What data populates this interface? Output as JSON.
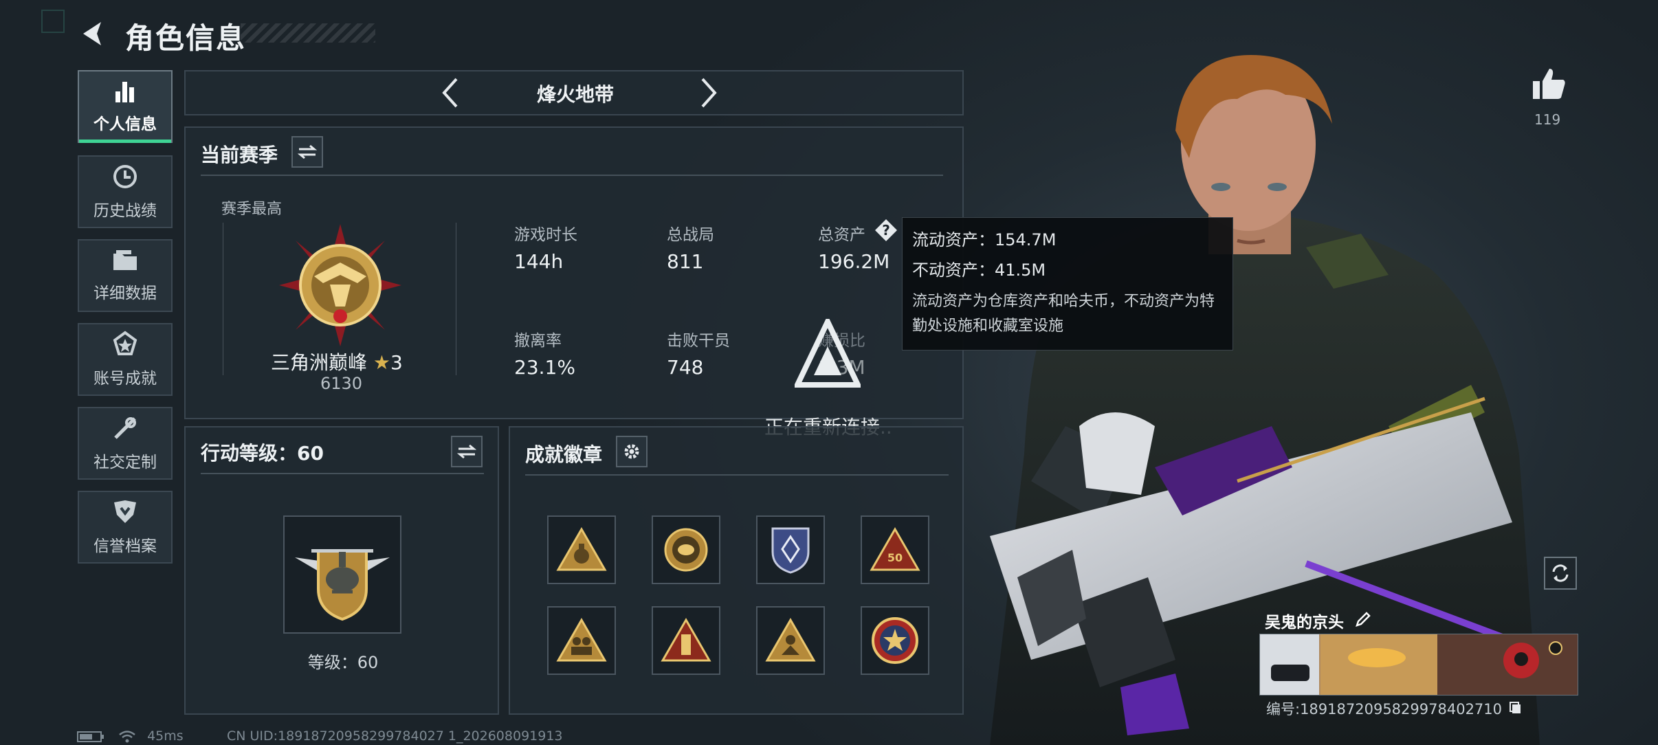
{
  "header": {
    "title": "角色信息"
  },
  "nav": [
    {
      "label": "个人信息",
      "icon": "bar-chart-icon",
      "active": true
    },
    {
      "label": "历史战绩",
      "icon": "clock-icon",
      "active": false
    },
    {
      "label": "详细数据",
      "icon": "folder-icon",
      "active": false
    },
    {
      "label": "账号成就",
      "icon": "medal-icon",
      "active": false
    },
    {
      "label": "社交定制",
      "icon": "wrench-icon",
      "active": false
    },
    {
      "label": "信誉档案",
      "icon": "shield-icon",
      "active": false
    }
  ],
  "mode": {
    "label": "烽火地带"
  },
  "season": {
    "title": "当前赛季",
    "best_label": "赛季最高",
    "rank_name": "三角洲巅峰",
    "rank_stars": "3",
    "rank_score": "6130",
    "stats": [
      {
        "label": "游戏时长",
        "value": "144h"
      },
      {
        "label": "总战局",
        "value": "811"
      },
      {
        "label": "总资产",
        "value": "196.2M"
      },
      {
        "label": "撤离率",
        "value": "23.1%"
      },
      {
        "label": "击败干员",
        "value": "748"
      },
      {
        "label": "赚损比",
        "value": "1.3M"
      }
    ]
  },
  "tooltip": {
    "line1": "流动资产：154.7M",
    "line2": "不动资产：41.5M",
    "desc": "流动资产为仓库资产和哈夫币，不动资产为特勤处设施和收藏室设施"
  },
  "reconnect": "正在重新连接..",
  "level": {
    "title": "行动等级：60",
    "caption": "等级：60"
  },
  "badges": {
    "title": "成就徽章"
  },
  "likes": {
    "count": "119"
  },
  "card": {
    "name": "吴鬼的京头",
    "id": "编号:1891872095829978402710"
  },
  "status": {
    "latency": "45ms",
    "uid": "CN UID:18918720958299784027 1_202608091913"
  },
  "colors": {
    "accent": "#3fd394",
    "gold": "#c9a04a"
  }
}
